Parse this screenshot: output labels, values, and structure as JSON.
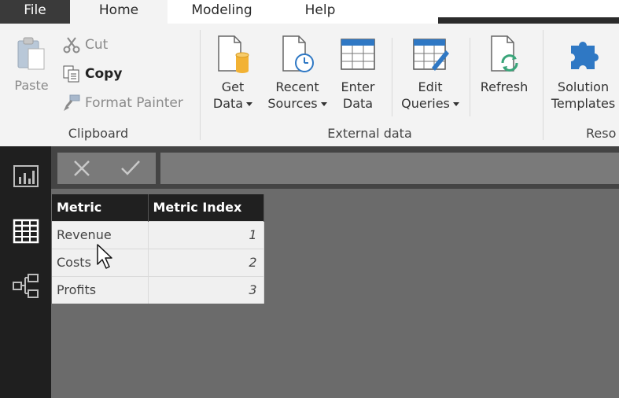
{
  "tabs": {
    "file": "File",
    "home": "Home",
    "modeling": "Modeling",
    "help": "Help"
  },
  "ribbon": {
    "clipboard": {
      "paste": "Paste",
      "cut": "Cut",
      "copy": "Copy",
      "format_painter": "Format Painter",
      "group_label": "Clipboard"
    },
    "external_data": {
      "get_data": [
        "Get",
        "Data"
      ],
      "recent_sources": [
        "Recent",
        "Sources"
      ],
      "enter_data": [
        "Enter",
        "Data"
      ],
      "edit_queries": [
        "Edit",
        "Queries"
      ],
      "refresh": "Refresh",
      "group_label": "External data"
    },
    "resources": {
      "solution_templates": [
        "Solution",
        "Templates"
      ],
      "group_label": "Reso"
    }
  },
  "table": {
    "columns": [
      "Metric",
      "Metric Index"
    ],
    "rows": [
      [
        "Revenue",
        "1"
      ],
      [
        "Costs",
        "2"
      ],
      [
        "Profits",
        "3"
      ]
    ]
  },
  "icons": {
    "nav": [
      "report-view-icon",
      "data-view-icon",
      "relationships-view-icon"
    ],
    "formula_bar": [
      "cancel-x-icon",
      "commit-check-icon"
    ]
  },
  "colors": {
    "nav_bg": "#1f1f1f",
    "header_bg": "#202020",
    "ribbon_bg": "#f3f3f3",
    "canvas_bg": "#6b6b6b",
    "accent_blue": "#2f78c4",
    "accent_gold": "#f2b234"
  }
}
